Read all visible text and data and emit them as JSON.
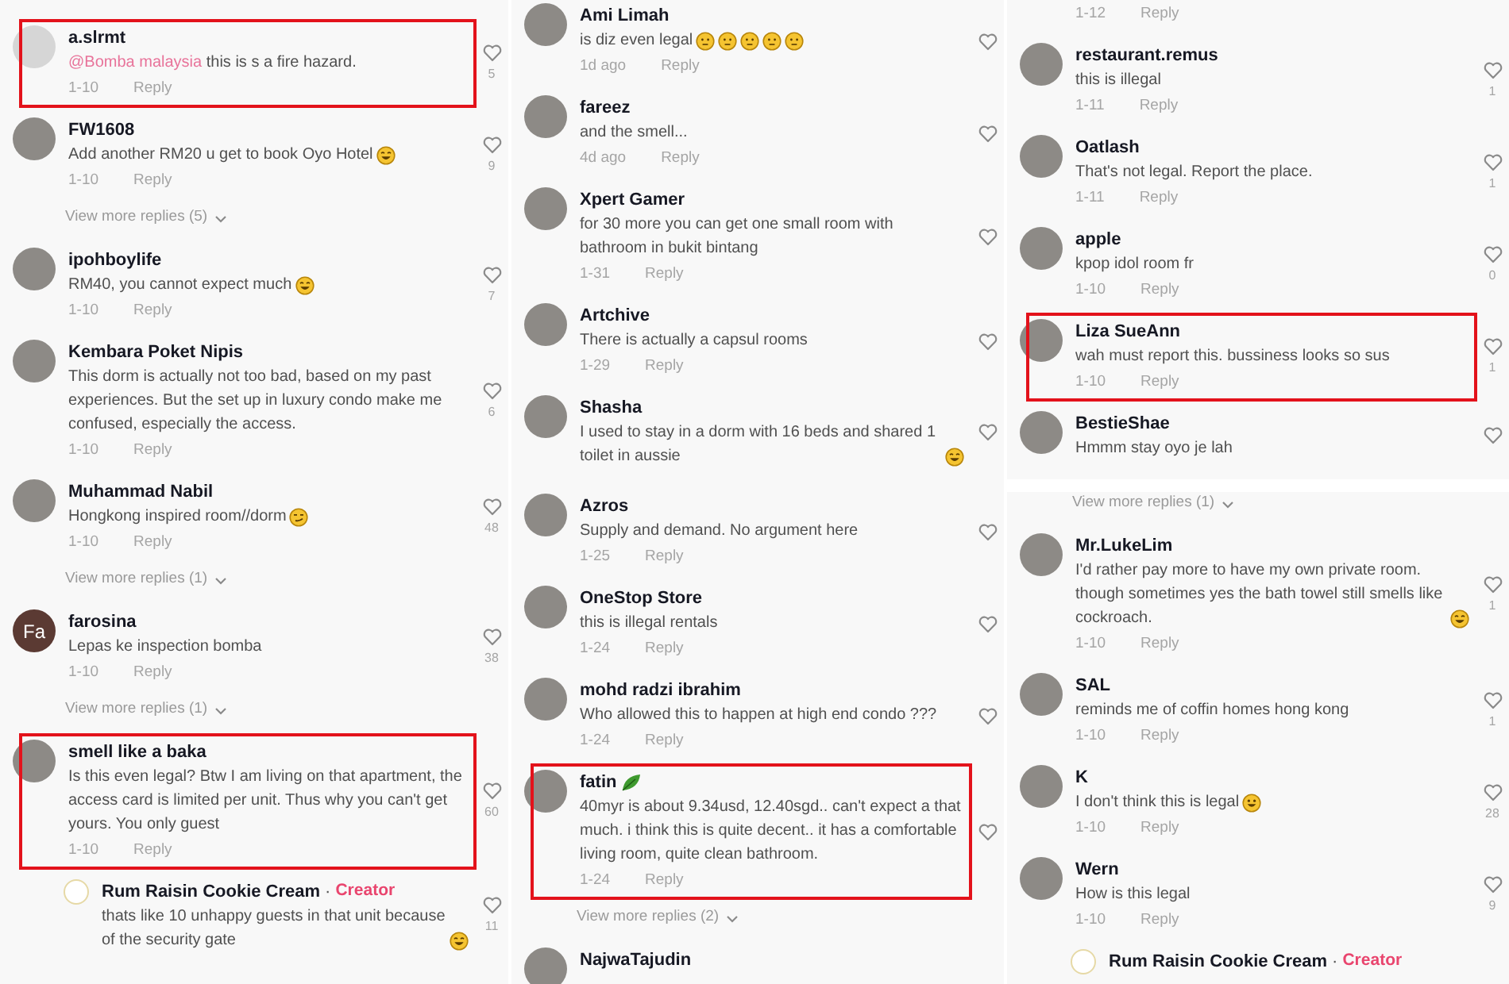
{
  "panels": [
    {
      "sections": [
        {
          "items": [
            {
              "kind": "comment",
              "avatar": {
                "kind": "default"
              },
              "name": "a.slrmt",
              "mention": "@Bomba malaysia",
              "text": "this is s a fire hazard.",
              "date": "1-10",
              "reply": "Reply",
              "heart": true,
              "likes": "5",
              "highlighted": true
            },
            {
              "kind": "comment",
              "avatar": {
                "kind": "photo"
              },
              "name": "FW1608",
              "text": "Add another RM20 u get to book Oyo Hotel",
              "emojis": [
                {
                  "kind": "laugh"
                }
              ],
              "date": "1-10",
              "reply": "Reply",
              "heart": true,
              "likes": "9",
              "highlighted": false
            },
            {
              "kind": "more",
              "label": "View more replies (5)"
            },
            {
              "kind": "comment",
              "avatar": {
                "kind": "photo"
              },
              "name": "ipohboylife",
              "text": "RM40, you cannot expect much",
              "emojis": [
                {
                  "kind": "laugh"
                }
              ],
              "date": "1-10",
              "reply": "Reply",
              "heart": true,
              "likes": "7",
              "highlighted": false
            },
            {
              "kind": "comment",
              "avatar": {
                "kind": "photo"
              },
              "name": "Kembara Poket Nipis",
              "text": "This dorm is actually not too bad, based on my past experiences. But the set up in luxury condo make me confused, especially the access.",
              "date": "1-10",
              "reply": "Reply",
              "heart": true,
              "likes": "6",
              "highlighted": false
            },
            {
              "kind": "comment",
              "avatar": {
                "kind": "photo"
              },
              "name": "Muhammad Nabil",
              "text": "Hongkong inspired room//dorm",
              "emojis": [
                {
                  "kind": "smirk"
                }
              ],
              "date": "1-10",
              "reply": "Reply",
              "heart": true,
              "likes": "48",
              "highlighted": false
            },
            {
              "kind": "more",
              "label": "View more replies (1)"
            },
            {
              "kind": "comment",
              "avatar": {
                "kind": "initials",
                "text": "Fa"
              },
              "name": "farosina",
              "text": "Lepas ke inspection bomba",
              "date": "1-10",
              "reply": "Reply",
              "heart": true,
              "likes": "38",
              "highlighted": false
            },
            {
              "kind": "more",
              "label": "View more replies (1)"
            },
            {
              "kind": "comment",
              "avatar": {
                "kind": "photo"
              },
              "name": "smell like a baka",
              "text": "Is this even legal? Btw I am living on that apartment, the access card is limited per unit. Thus why you can't get yours. You only guest",
              "date": "1-10",
              "reply": "Reply",
              "heart": true,
              "likes": "60",
              "highlighted": true
            },
            {
              "kind": "reply",
              "avatar": {
                "kind": "creator"
              },
              "name": "Rum Raisin Cookie Cream",
              "separator": "·",
              "badge": "Creator",
              "text": "thats like 10 unhappy guests in that unit because of the security gate",
              "emojis": [
                {
                  "kind": "laugh"
                }
              ],
              "heart": true,
              "likes": "11",
              "highlighted": false
            }
          ]
        }
      ]
    },
    {
      "sections": [
        {
          "items": [
            {
              "kind": "comment",
              "avatar": {
                "kind": "photo"
              },
              "name": "Ami Limah",
              "text": "is diz even legal",
              "emojis": [
                {
                  "kind": "neutral"
                },
                {
                  "kind": "neutral"
                },
                {
                  "kind": "neutral"
                },
                {
                  "kind": "neutral"
                },
                {
                  "kind": "neutral"
                }
              ],
              "date": "1d ago",
              "reply": "Reply",
              "heart": true,
              "highlighted": false
            },
            {
              "kind": "comment",
              "avatar": {
                "kind": "photo"
              },
              "name": "fareez",
              "text": "and the smell...",
              "date": "4d ago",
              "reply": "Reply",
              "heart": true,
              "highlighted": false
            },
            {
              "kind": "comment",
              "avatar": {
                "kind": "photo"
              },
              "name": "Xpert Gamer",
              "text": "for 30 more you can get one small room with bathroom in bukit bintang",
              "date": "1-31",
              "reply": "Reply",
              "heart": true,
              "highlighted": false
            },
            {
              "kind": "comment",
              "avatar": {
                "kind": "photo"
              },
              "name": "Artchive",
              "text": "There is actually a capsul rooms",
              "date": "1-29",
              "reply": "Reply",
              "heart": true,
              "highlighted": false
            },
            {
              "kind": "comment",
              "avatar": {
                "kind": "photo"
              },
              "name": "Shasha",
              "text": "I used to stay in a dorm with 16 beds and shared 1 toilet in aussie",
              "emojis": [
                {
                  "kind": "laugh"
                }
              ],
              "heart": true,
              "highlighted": false
            }
          ]
        },
        {
          "items": [
            {
              "kind": "comment",
              "avatar": {
                "kind": "photo"
              },
              "name": "Azros",
              "text": "Supply and demand. No argument here",
              "date": "1-25",
              "reply": "Reply",
              "heart": true,
              "highlighted": false
            },
            {
              "kind": "comment",
              "avatar": {
                "kind": "photo"
              },
              "name": "OneStop Store",
              "text": "this is illegal rentals",
              "date": "1-24",
              "reply": "Reply",
              "heart": true,
              "highlighted": false
            },
            {
              "kind": "comment",
              "avatar": {
                "kind": "photo"
              },
              "name": "mohd radzi ibrahim",
              "text": "Who allowed this to happen at high end condo ???",
              "date": "1-24",
              "reply": "Reply",
              "heart": true,
              "highlighted": false
            },
            {
              "kind": "comment",
              "avatar": {
                "kind": "photo"
              },
              "name": "fatin",
              "name_emoji": {
                "kind": "leaf"
              },
              "text": "40myr is about 9.34usd, 12.40sgd.. can't expect a that much. i think this is quite decent.. it has a comfortable living room, quite clean bathroom.",
              "date": "1-24",
              "reply": "Reply",
              "heart": true,
              "highlighted": true
            },
            {
              "kind": "more",
              "label": "View more replies (2)"
            },
            {
              "kind": "comment",
              "avatar": {
                "kind": "photo"
              },
              "name": "NajwaTajudin",
              "heart": false,
              "highlighted": false
            }
          ]
        }
      ]
    },
    {
      "sections": [
        {
          "items": [
            {
              "kind": "comment",
              "date": "1-12",
              "reply": "Reply",
              "heart": false,
              "highlighted": false
            },
            {
              "kind": "comment",
              "avatar": {
                "kind": "photo"
              },
              "name": "restaurant.remus",
              "text": "this is illegal",
              "date": "1-11",
              "reply": "Reply",
              "heart": true,
              "likes": "1",
              "highlighted": false
            },
            {
              "kind": "comment",
              "avatar": {
                "kind": "photo"
              },
              "name": "Oatlash",
              "text": "That's not legal. Report the place.",
              "date": "1-11",
              "reply": "Reply",
              "heart": true,
              "likes": "1",
              "highlighted": false
            },
            {
              "kind": "comment",
              "avatar": {
                "kind": "photo"
              },
              "name": "apple",
              "text": "kpop idol room fr",
              "date": "1-10",
              "reply": "Reply",
              "heart": true,
              "likes": "0",
              "highlighted": false
            },
            {
              "kind": "comment",
              "avatar": {
                "kind": "photo"
              },
              "name": "Liza SueAnn",
              "text": "wah must report this. bussiness looks so sus",
              "date": "1-10",
              "reply": "Reply",
              "heart": true,
              "likes": "1",
              "highlighted": true
            },
            {
              "kind": "comment",
              "avatar": {
                "kind": "photo"
              },
              "name": "BestieShae",
              "text": "Hmmm stay oyo je lah",
              "heart": true,
              "highlighted": false
            }
          ]
        },
        {
          "items": [
            {
              "kind": "more",
              "label": "View more replies (1)"
            },
            {
              "kind": "comment",
              "avatar": {
                "kind": "photo"
              },
              "name": "Mr.LukeLim",
              "text": "I'd rather pay more to have my own private room. though sometimes yes the bath towel still smells like cockroach.",
              "emojis": [
                {
                  "kind": "laugh"
                }
              ],
              "date": "1-10",
              "reply": "Reply",
              "heart": true,
              "likes": "1",
              "highlighted": false
            },
            {
              "kind": "comment",
              "avatar": {
                "kind": "photo"
              },
              "name": "SAL",
              "text": "reminds me of coffin homes hong kong",
              "date": "1-10",
              "reply": "Reply",
              "heart": true,
              "likes": "1",
              "highlighted": false
            },
            {
              "kind": "comment",
              "avatar": {
                "kind": "photo"
              },
              "name": "K",
              "text": "I don't think this is legal",
              "emojis": [
                {
                  "kind": "grin"
                }
              ],
              "date": "1-10",
              "reply": "Reply",
              "heart": true,
              "likes": "28",
              "highlighted": false
            },
            {
              "kind": "comment",
              "avatar": {
                "kind": "photo"
              },
              "name": "Wern",
              "text": "How is this legal",
              "date": "1-10",
              "reply": "Reply",
              "heart": true,
              "likes": "9",
              "highlighted": false
            },
            {
              "kind": "reply",
              "avatar": {
                "kind": "creator"
              },
              "name": "Rum Raisin Cookie Cream",
              "separator": "·",
              "badge": "Creator",
              "heart": false,
              "highlighted": false
            }
          ]
        }
      ]
    }
  ]
}
